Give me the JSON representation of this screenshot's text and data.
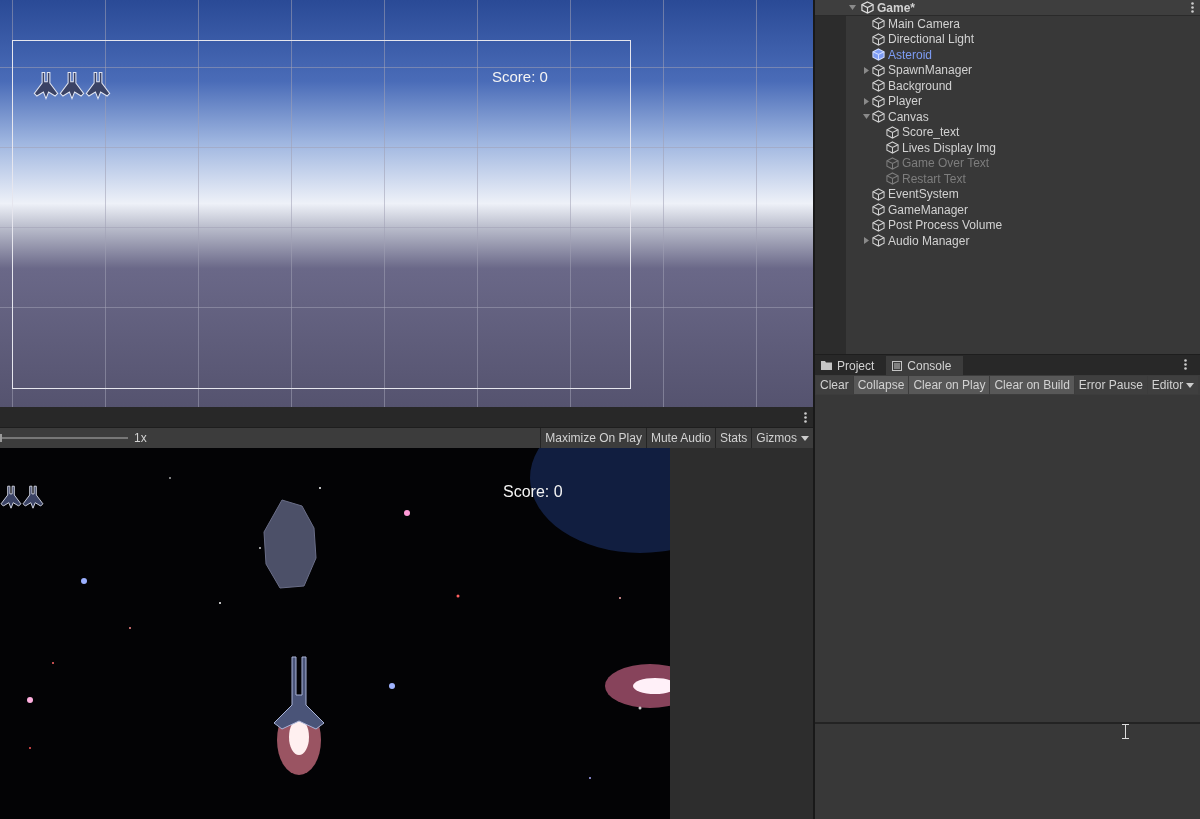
{
  "scene_view": {
    "score": "Score: 0"
  },
  "game_toolbar": {
    "scale_slider": {
      "level": 0
    },
    "scale": "1x",
    "buttons": [
      {
        "label": "Maximize On Play",
        "selected": false,
        "kind": "toggle"
      },
      {
        "label": "Mute Audio",
        "selected": false,
        "kind": "toggle"
      },
      {
        "label": "Stats",
        "selected": false,
        "kind": "toggle"
      },
      {
        "label": "Gizmos",
        "selected": false,
        "kind": "dropdown"
      }
    ]
  },
  "game_view": {
    "score": "Score: 0"
  },
  "hierarchy": {
    "scene": {
      "name": "Game*",
      "expanded": true
    },
    "items": [
      {
        "name": "Main Camera",
        "active": true,
        "prefab": false
      },
      {
        "name": "Directional Light",
        "active": true,
        "prefab": false
      },
      {
        "name": "Asteroid",
        "active": true,
        "prefab": true
      },
      {
        "name": "SpawnManager",
        "expanded": false,
        "active": true,
        "prefab": false
      },
      {
        "name": "Background",
        "active": true,
        "prefab": false
      },
      {
        "name": "Player",
        "expanded": false,
        "active": true,
        "prefab": false
      },
      {
        "name": "Canvas",
        "expanded": true,
        "active": true,
        "prefab": false,
        "children": [
          {
            "name": "Score_text",
            "active": true,
            "prefab": false
          },
          {
            "name": "Lives Display Img",
            "active": true,
            "prefab": false
          },
          {
            "name": "Game Over Text",
            "active": false,
            "prefab": false
          },
          {
            "name": "Restart Text",
            "active": false,
            "prefab": false
          }
        ]
      },
      {
        "name": "EventSystem",
        "active": true,
        "prefab": false
      },
      {
        "name": "GameManager",
        "active": true,
        "prefab": false
      },
      {
        "name": "Post Process Volume",
        "active": true,
        "prefab": false
      },
      {
        "name": "Audio Manager",
        "expanded": false,
        "active": true,
        "prefab": false
      }
    ]
  },
  "console": {
    "tabs": [
      {
        "label": "Project",
        "selected": false,
        "kind": "folder"
      },
      {
        "label": "Console",
        "selected": true,
        "kind": "console"
      }
    ],
    "toggles": [
      {
        "label": "Clear",
        "selected": false,
        "kind": "button"
      },
      {
        "label": "Collapse",
        "selected": true,
        "kind": "toggle"
      },
      {
        "label": "Clear on Play",
        "selected": true,
        "kind": "toggle"
      },
      {
        "label": "Clear on Build",
        "selected": true,
        "kind": "toggle"
      },
      {
        "label": "Error Pause",
        "selected": false,
        "kind": "toggle"
      },
      {
        "label": "Editor",
        "selected": false,
        "kind": "dropdown"
      }
    ]
  }
}
